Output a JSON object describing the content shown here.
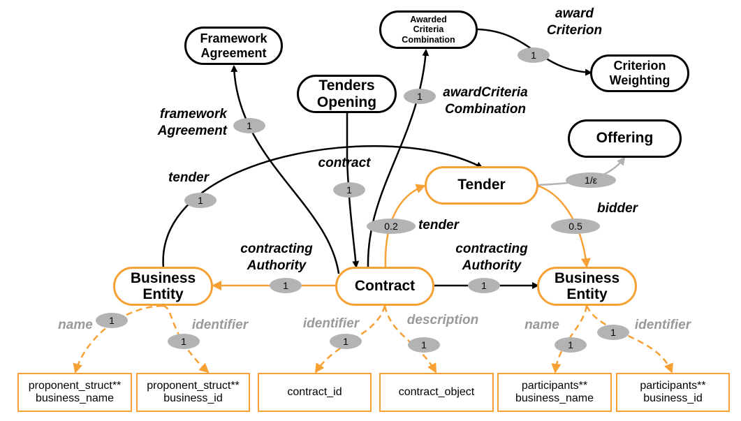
{
  "colors": {
    "mandatory": "#000000",
    "orange": "#f7a033",
    "optional": "#b3b3b3",
    "attribute_label": "#999999"
  },
  "nodes": {
    "framework_agreement": "Framework\nAgreement",
    "awarded_criteria_combination": "Awarded\nCriteria\nCombination",
    "criterion_weighting": "Criterion\nWeighting",
    "tenders_opening": "Tenders\nOpening",
    "offering": "Offering",
    "tender": "Tender",
    "business_entity_left": "Business\nEntity",
    "contract": "Contract",
    "business_entity_right": "Business\nEntity"
  },
  "attributes": {
    "proponent_business_name": "proponent_struct**\nbusiness_name",
    "proponent_business_id": "proponent_struct**\nbusiness_id",
    "contract_id": "contract_id",
    "contract_object": "contract_object",
    "participants_business_name": "participants**\nbusiness_name",
    "participants_business_id": "participants**\nbusiness_id"
  },
  "edge_labels": {
    "award_criterion": "award\nCriterion",
    "award_criteria_combination": "awardCriteria\nCombination",
    "framework_agreement": "framework\nAgreement",
    "contract": "contract",
    "tender_left": "tender",
    "tender_mid": "tender",
    "bidder": "bidder",
    "contracting_authority_left": "contracting\nAuthority",
    "contracting_authority_right": "contracting\nAuthority",
    "name_left": "name",
    "identifier_left": "identifier",
    "identifier_contract": "identifier",
    "description": "description",
    "name_right": "name",
    "identifier_right": "identifier"
  },
  "cardinalities": {
    "award_criterion": "1",
    "award_criteria_combination": "1",
    "framework_agreement": "1",
    "contract": "1",
    "tender_left": "1",
    "tender_mid": "0.2",
    "offering": "1/ε",
    "bidder": "0.5",
    "contracting_authority_left": "1",
    "contracting_authority_right": "1",
    "name_left": "1",
    "identifier_left": "1",
    "identifier_contract": "1",
    "description": "1",
    "name_right": "1",
    "identifier_right": "1"
  }
}
